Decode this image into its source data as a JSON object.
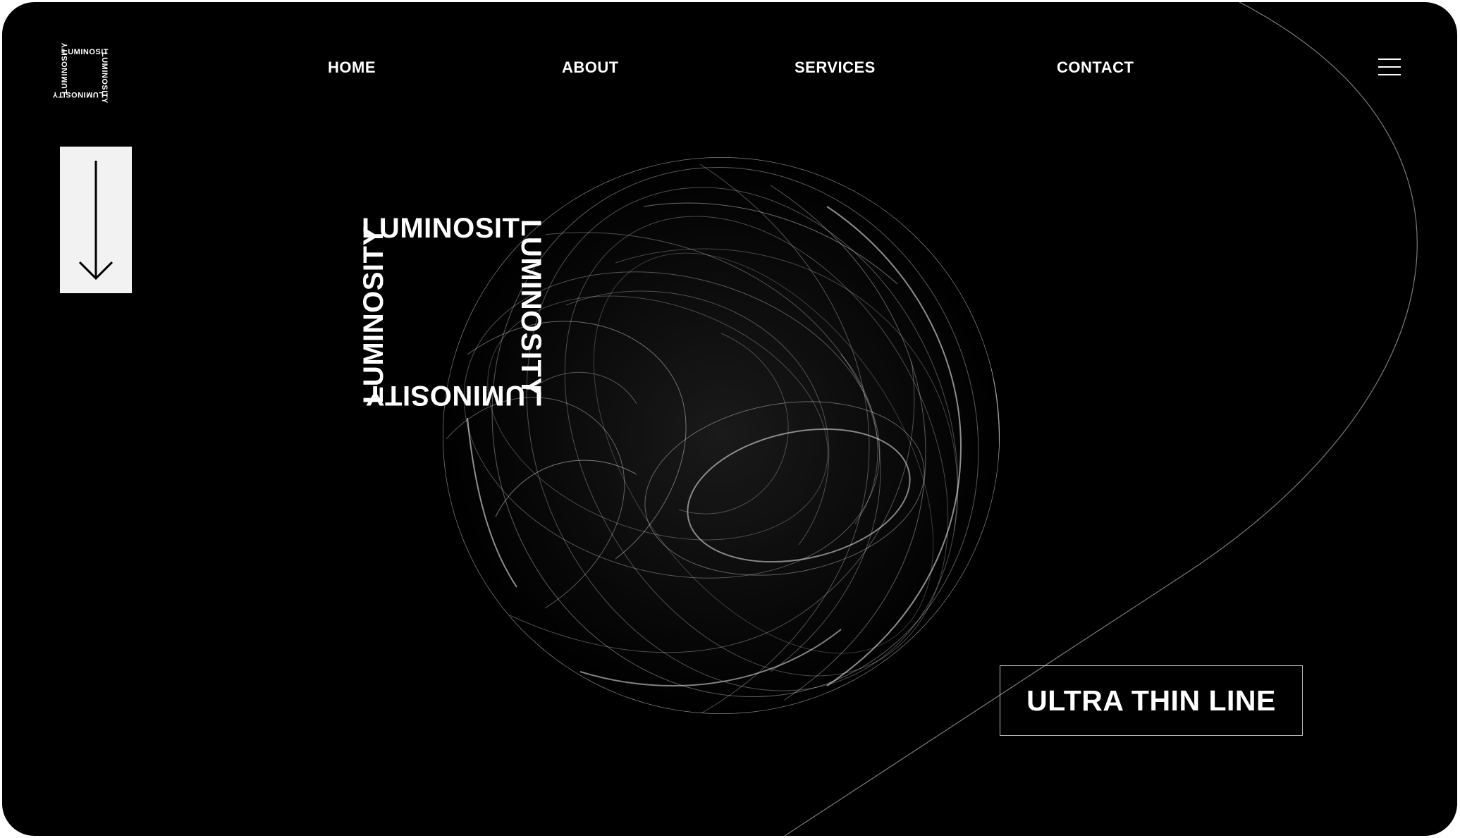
{
  "brand": {
    "logo_text": "LUMINOSITY",
    "logo_text_top": "LUMINOSIT"
  },
  "nav": {
    "items": [
      {
        "label": "HOME"
      },
      {
        "label": "ABOUT"
      },
      {
        "label": "SERVICES"
      },
      {
        "label": "CONTACT"
      }
    ]
  },
  "icons": {
    "menu": "hamburger-menu-icon",
    "scroll": "arrow-down-icon"
  },
  "hero": {
    "logo_text": "LUMINOSITY",
    "logo_text_top": "LUMINOSIT",
    "cta_label": "ULTRA THIN LINE"
  },
  "colors": {
    "background": "#000000",
    "foreground": "#ffffff",
    "scroll_box": "#f2f2f2",
    "page_backdrop": "#ffffff"
  }
}
